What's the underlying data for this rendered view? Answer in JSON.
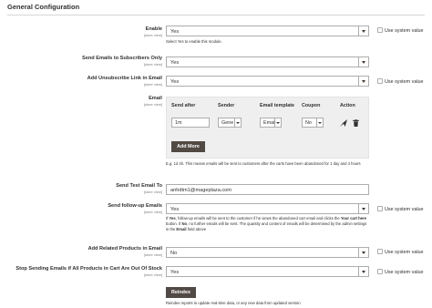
{
  "section_title": "General Configuration",
  "scope_label": "[store view]",
  "use_system_value": "Use system value",
  "fields": {
    "enable": {
      "label": "Enable",
      "value": "Yes",
      "note": "Select Yes to enable this module."
    },
    "send_emails_subscribers": {
      "label": "Send Emails to Subscribers Only",
      "value": "Yes"
    },
    "unsubscribe_link": {
      "label": "Add Unsubscribe Link in Email",
      "value": "Yes"
    },
    "email": {
      "label": "Email",
      "columns": [
        "Send after",
        "Sender",
        "Email template",
        "Coupon",
        "Action"
      ],
      "row": {
        "send_after": "1m",
        "sender": "Gene",
        "email_template": "Email",
        "coupon": "No"
      },
      "add_more_label": "Add More",
      "note": "E.g. 1d 4h. This means emails will be sent to customers after the carts have been abandoned for 1 day and 4 hours"
    },
    "test_email": {
      "label": "Send Test Email To",
      "value": "anhdtm1@mageplaza.com"
    },
    "follow_up": {
      "label": "Send follow-up Emails",
      "value": "Yes",
      "note_parts": {
        "p1": "If ",
        "b1": "Yes",
        "p2": ", follow-up emails will be sent to the customer if he views the abandoned cart email and clicks the ",
        "b2": "Your cart here",
        "p3": " button. If ",
        "b3": "No",
        "p4": ", no further emails will be sent. The quantity and content of emails will be determined by the admin settings in the ",
        "b4": "Email",
        "p5": " field above"
      }
    },
    "related_products": {
      "label": "Add Related Products in Email",
      "value": "No"
    },
    "stop_sending": {
      "label": "Stop Sending Emails if All Products in Cart Are Out Of Stock",
      "value": "Yes"
    },
    "reindex": {
      "button_label": "Reindex",
      "note": "Reindex reports to update real-time data, or any new data from updated version"
    }
  },
  "icons": {
    "send": "send-icon",
    "delete": "trash-icon",
    "dropdown": "chevron-down-icon"
  },
  "colors": {
    "button_dark": "#514943",
    "table_bg": "#efefef",
    "border": "#adadad"
  }
}
